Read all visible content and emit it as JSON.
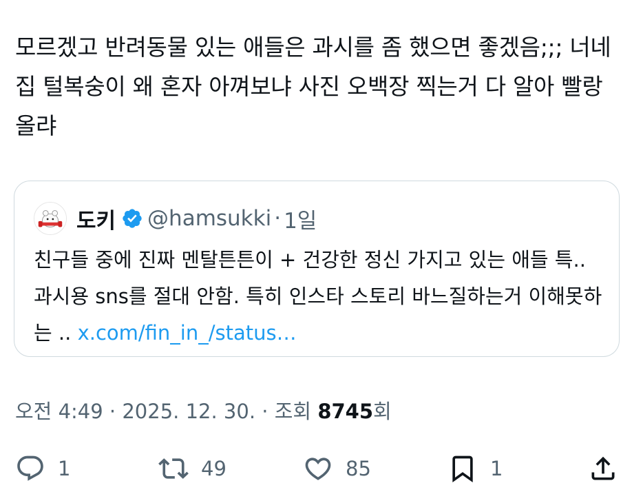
{
  "tweet": {
    "text": "모르겠고 반려동물 있는 애들은 과시를 좀 했으면 좋겠음;;; 너네 집 털복숭이 왜 혼자 아껴보냐 사진 오백장 찍는거 다 알아 빨랑 올랴"
  },
  "quote": {
    "name": "도키",
    "handle": "@hamsukki",
    "separator": "·",
    "time": "1일",
    "text": "친구들 중에 진짜 멘탈튼튼이 + 건강한 정신 가지고 있는 애들 특.. 과시용 sns를 절대 안함. 특히 인스타 스토리 바느질하는거 이해못하는 ..",
    "link": "x.com/fin_in_/status…",
    "verified_color": "#1d9bf0"
  },
  "meta": {
    "time": "오전 4:49",
    "sep1": " · ",
    "date": "2025. 12. 30.",
    "sep2": " · ",
    "views_label": "조회 ",
    "views_count": "8745",
    "views_suffix": "회"
  },
  "actions": {
    "replies": "1",
    "retweets": "49",
    "likes": "85",
    "bookmarks": "1"
  },
  "icons": [
    "reply-icon",
    "retweet-icon",
    "like-icon",
    "bookmark-icon",
    "share-icon",
    "verified-badge-icon"
  ]
}
